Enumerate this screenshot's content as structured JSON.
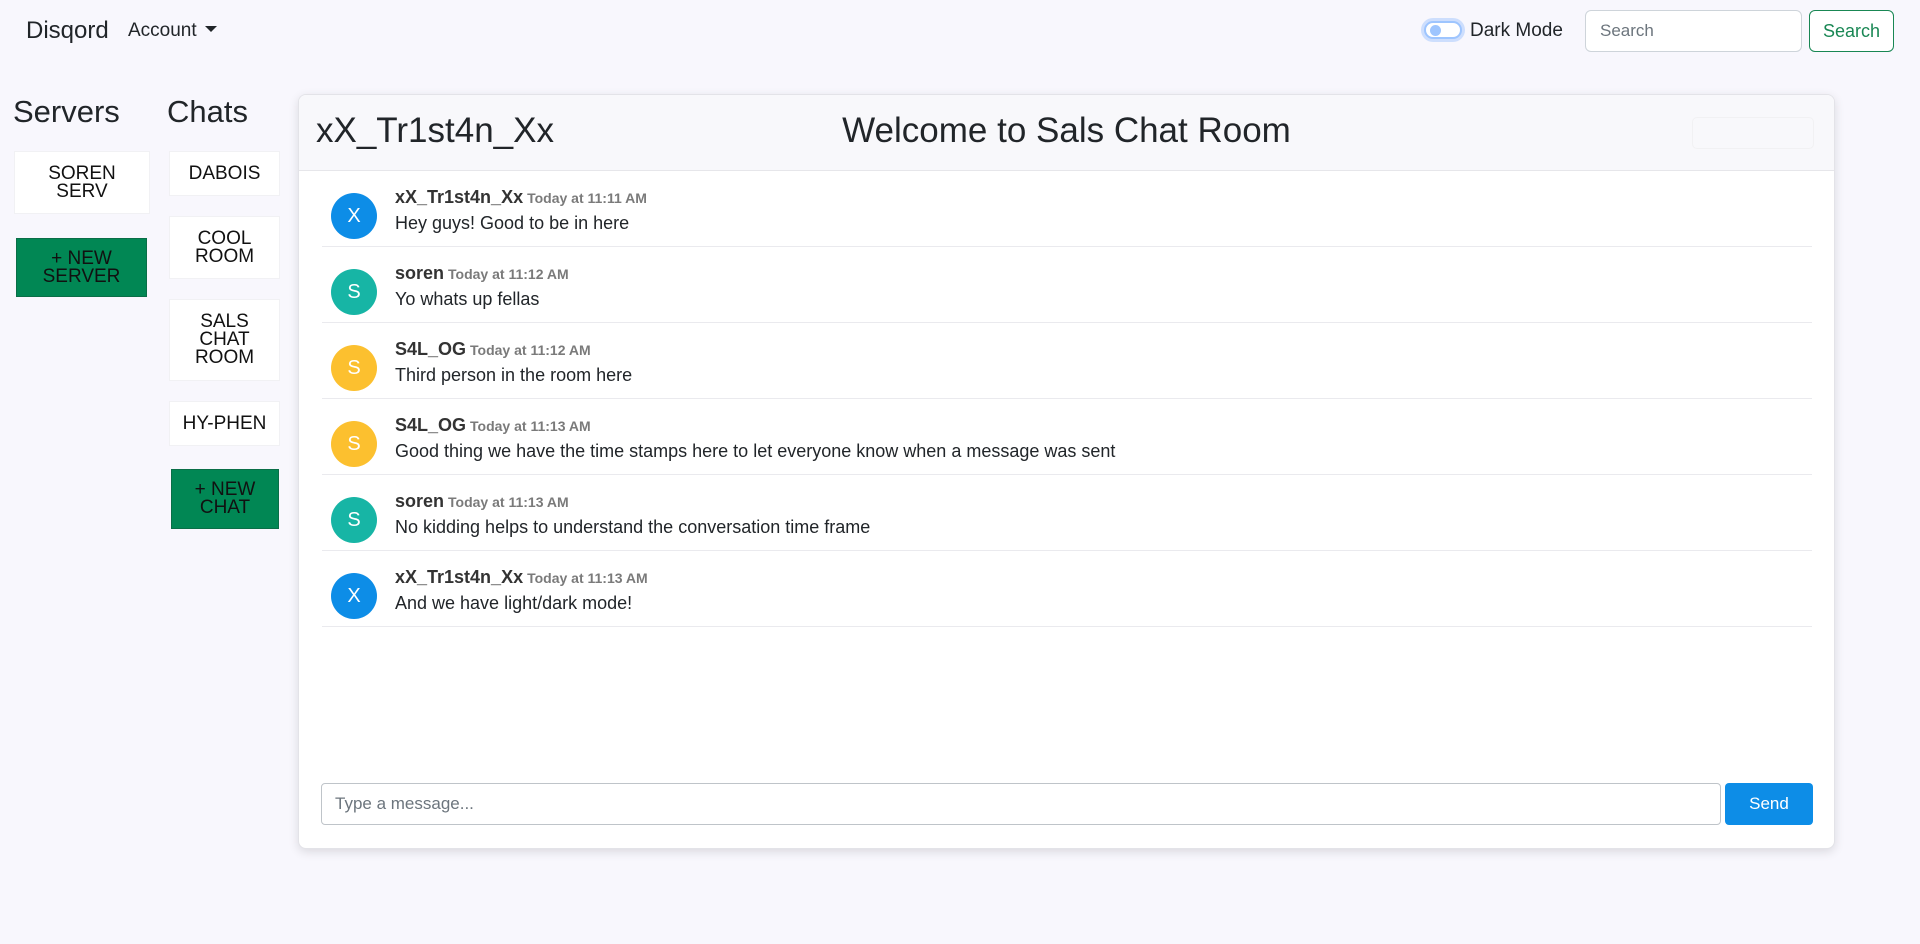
{
  "navbar": {
    "brand": "Disqord",
    "account_label": "Account",
    "dark_mode_label": "Dark Mode",
    "search_placeholder": "Search",
    "search_button": "Search"
  },
  "servers": {
    "title": "Servers",
    "items": [
      {
        "label": "SOREN SERV"
      }
    ],
    "new_label": "+ NEW SERVER"
  },
  "chats": {
    "title": "Chats",
    "items": [
      {
        "label": "DABOIS"
      },
      {
        "label": "COOL ROOM"
      },
      {
        "label": "SALS CHAT ROOM"
      },
      {
        "label": "HY-PHEN"
      }
    ],
    "new_label": "+ NEW CHAT"
  },
  "room": {
    "current_user": "xX_Tr1st4n_Xx",
    "title": "Welcome to Sals Chat Room"
  },
  "messages": [
    {
      "initial": "X",
      "author": "xX_Tr1st4n_Xx",
      "time": "Today at 11:11 AM",
      "text": "Hey guys! Good to be in here",
      "color": "#0d8de7"
    },
    {
      "initial": "S",
      "author": "soren",
      "time": "Today at 11:12 AM",
      "text": "Yo whats up fellas",
      "color": "#17b5a5"
    },
    {
      "initial": "S",
      "author": "S4L_OG",
      "time": "Today at 11:12 AM",
      "text": "Third person in the room here",
      "color": "#fcc02f"
    },
    {
      "initial": "S",
      "author": "S4L_OG",
      "time": "Today at 11:13 AM",
      "text": "Good thing we have the time stamps here to let everyone know when a message was sent",
      "color": "#fcc02f"
    },
    {
      "initial": "S",
      "author": "soren",
      "time": "Today at 11:13 AM",
      "text": "No kidding helps to understand the conversation time frame",
      "color": "#17b5a5"
    },
    {
      "initial": "X",
      "author": "xX_Tr1st4n_Xx",
      "time": "Today at 11:13 AM",
      "text": "And we have light/dark mode!",
      "color": "#0d8de7"
    }
  ],
  "composer": {
    "placeholder": "Type a message...",
    "send_label": "Send"
  },
  "colors": {
    "accent_green": "#018754",
    "send_blue": "#0d8de7"
  }
}
